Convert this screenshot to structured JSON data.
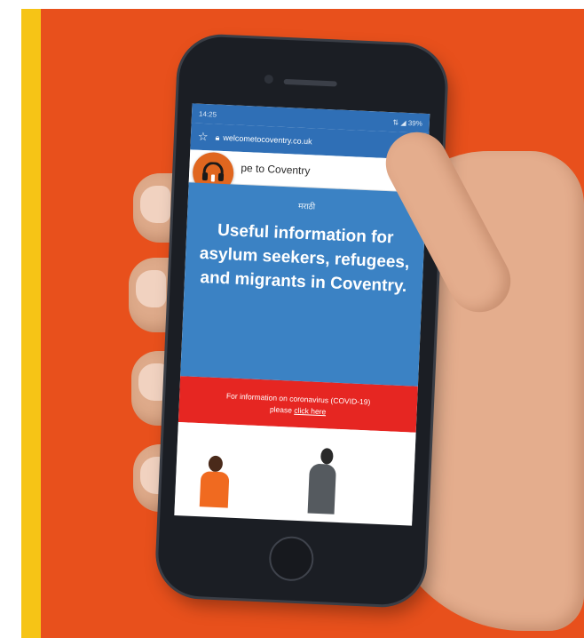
{
  "status_bar": {
    "time": "14:25",
    "right": "⇅ ◢ 39%"
  },
  "browser": {
    "url": "welcometocoventry.co.uk"
  },
  "site": {
    "title": "pe to Coventry",
    "language": "मराठी",
    "heading": "Useful information for asylum seekers, refugees, and migrants in Coventry.",
    "notice_line1": "For information on coronavirus (COVID-19)",
    "notice_prefix": "please",
    "notice_link": "click here"
  },
  "colors": {
    "background_orange": "#e8501c",
    "accent_yellow": "#f6c416",
    "site_blue": "#3b82c4",
    "notice_red": "#e62622",
    "audio_badge": "#e0661f"
  },
  "icons": [
    "star-icon",
    "lock-icon",
    "download-icon",
    "refresh-icon",
    "hamburger-menu-icon",
    "headphones-icon"
  ]
}
